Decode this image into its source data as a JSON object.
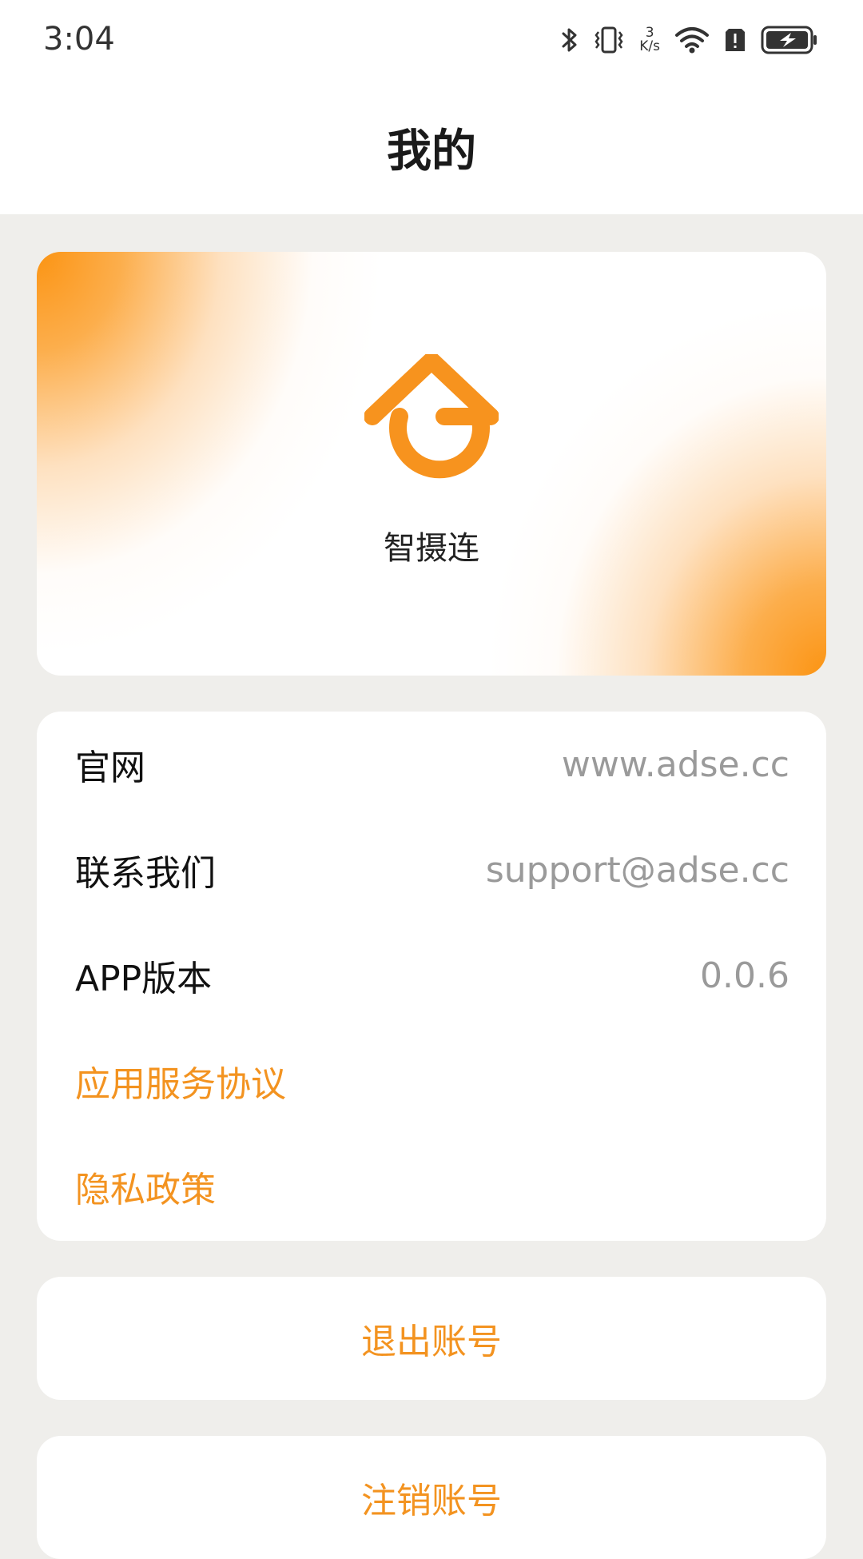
{
  "status_bar": {
    "time": "3:04",
    "net_speed_value": "3",
    "net_speed_unit": "K/s",
    "icons": [
      "bluetooth-icon",
      "vibrate-icon",
      "wifi-icon",
      "alert-icon",
      "battery-charging-icon"
    ]
  },
  "header": {
    "title": "我的"
  },
  "hero": {
    "app_name": "智摄连",
    "logo": "app-logo-house-g",
    "accent_color": "#fb9413"
  },
  "info": {
    "rows": [
      {
        "label": "官网",
        "value": "www.adse.cc"
      },
      {
        "label": "联系我们",
        "value": "support@adse.cc"
      },
      {
        "label": "APP版本",
        "value": "0.0.6"
      },
      {
        "label": "应用服务协议"
      },
      {
        "label": "隐私政策"
      }
    ]
  },
  "actions": {
    "logout": "退出账号",
    "deregister": "注销账号"
  },
  "colors": {
    "link": "#f39320",
    "background": "#efeeeb",
    "secondary_text": "#9a9a9a"
  }
}
